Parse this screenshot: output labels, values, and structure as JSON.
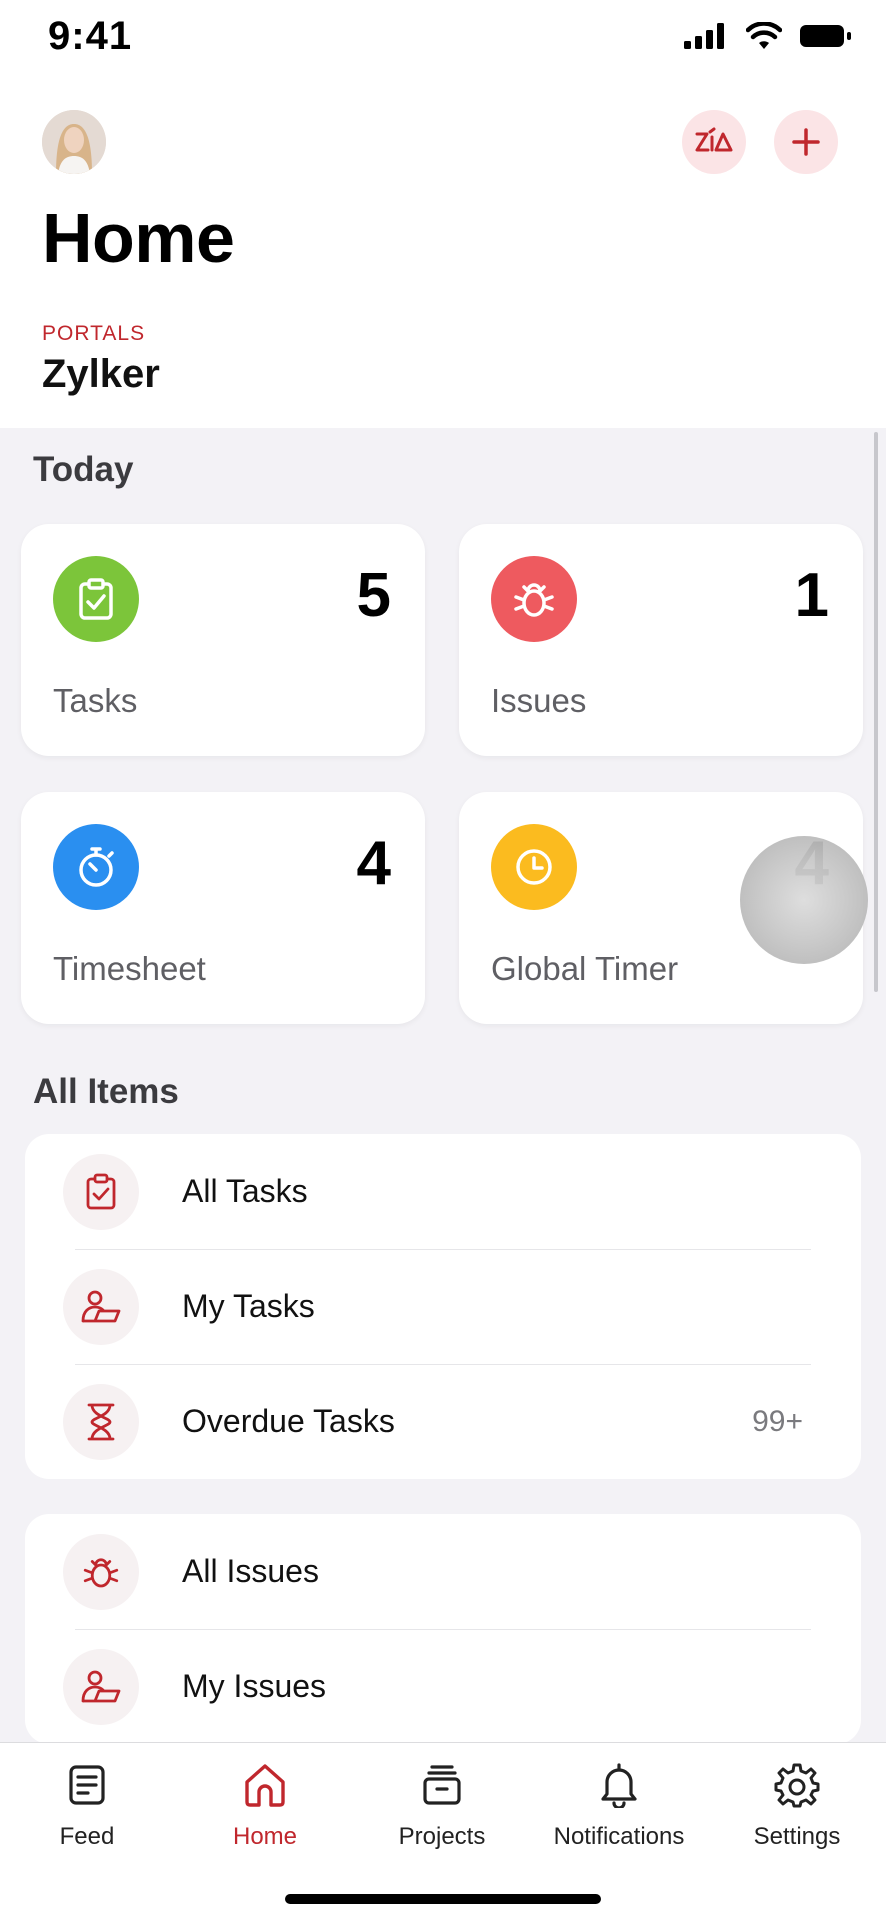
{
  "status_bar": {
    "time": "9:41"
  },
  "header": {
    "title": "Home",
    "portals_label": "PORTALS",
    "portal_name": "Zylker",
    "zia_icon": "zia-icon",
    "add_icon": "plus-icon"
  },
  "today": {
    "title": "Today",
    "cards": [
      {
        "label": "Tasks",
        "count": "5",
        "icon": "clipboard-check-icon",
        "color": "#7cc53a"
      },
      {
        "label": "Issues",
        "count": "1",
        "icon": "bug-icon",
        "color": "#ee5a5f"
      },
      {
        "label": "Timesheet",
        "count": "4",
        "icon": "stopwatch-icon",
        "color": "#2a8ff0"
      },
      {
        "label": "Global Timer",
        "count": "4",
        "icon": "clock-icon",
        "color": "#fbbb1f"
      }
    ]
  },
  "all_items": {
    "title": "All Items",
    "tasks_group": [
      {
        "label": "All Tasks",
        "icon": "clipboard-check-icon",
        "count": ""
      },
      {
        "label": "My Tasks",
        "icon": "user-task-icon",
        "count": ""
      },
      {
        "label": "Overdue Tasks",
        "icon": "hourglass-icon",
        "count": "99+"
      }
    ],
    "issues_group": [
      {
        "label": "All Issues",
        "icon": "bug-icon"
      },
      {
        "label": "My Issues",
        "icon": "user-task-icon"
      }
    ]
  },
  "tabbar": {
    "tabs": [
      {
        "label": "Feed",
        "icon": "feed-icon",
        "active": false
      },
      {
        "label": "Home",
        "icon": "home-icon",
        "active": true
      },
      {
        "label": "Projects",
        "icon": "projects-icon",
        "active": false
      },
      {
        "label": "Notifications",
        "icon": "bell-icon",
        "active": false
      },
      {
        "label": "Settings",
        "icon": "gear-icon",
        "active": false
      }
    ]
  },
  "colors": {
    "accent": "#c0272d",
    "background": "#f3f2f6"
  }
}
